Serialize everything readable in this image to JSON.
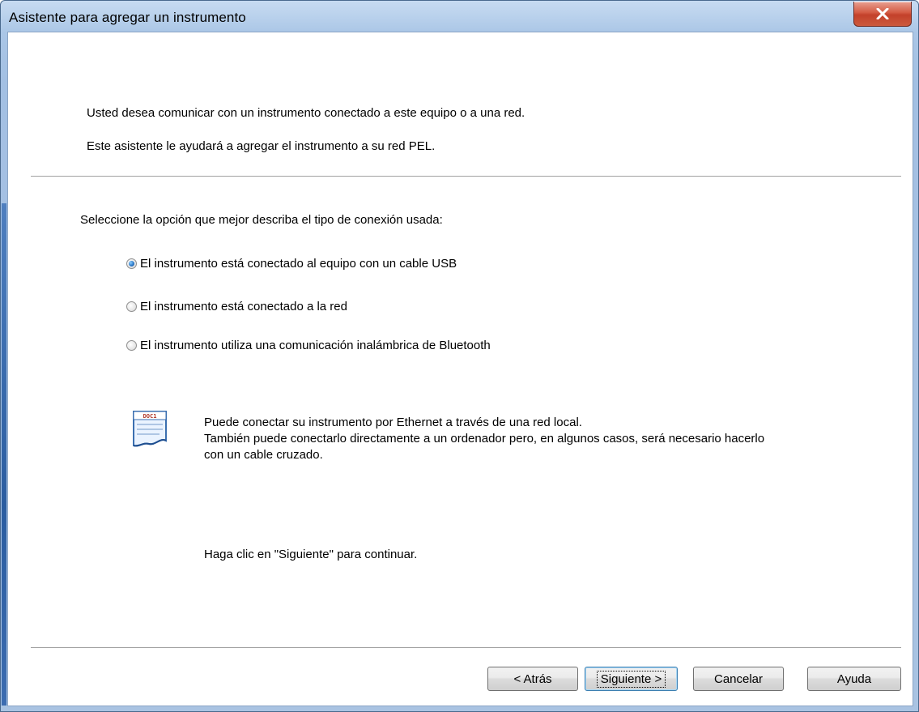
{
  "window": {
    "title": "Asistente para agregar un instrumento"
  },
  "intro": {
    "line1": "Usted desea comunicar con un instrumento conectado a este equipo o a una red.",
    "line2": "Este asistente le ayudará a agregar el instrumento a su red PEL."
  },
  "connection": {
    "prompt": "Seleccione la opción que mejor describa el tipo de conexión usada:",
    "options": [
      {
        "label": "El instrumento está conectado al equipo con un cable USB",
        "checked": true
      },
      {
        "label": "El instrumento está conectado a la red",
        "checked": false
      },
      {
        "label": "El instrumento utiliza una comunicación inalámbrica de Bluetooth",
        "checked": false
      }
    ]
  },
  "info": {
    "icon": "document-icon",
    "icon_label": "DOC1",
    "lines": [
      "Puede conectar su instrumento por Ethernet a través de una red local.",
      "También puede conectarlo directamente a un ordenador pero, en algunos casos, será necesario hacerlo",
      "con un cable cruzado."
    ]
  },
  "hint": "Haga clic en \"Siguiente\" para continuar.",
  "buttons": {
    "back": "< Atrás",
    "next": "Siguiente >",
    "cancel": "Cancelar",
    "help": "Ayuda"
  },
  "colors": {
    "title_bar": "#b9d1ec",
    "close_button": "#c3402a",
    "accent_radio": "#2b78c8"
  }
}
